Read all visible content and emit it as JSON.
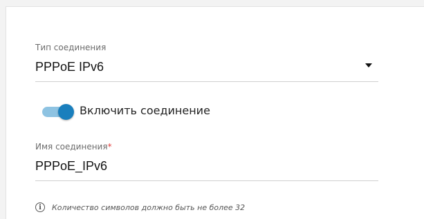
{
  "connection_type": {
    "label": "Тип соединения",
    "value": "PPPoE IPv6"
  },
  "enable_toggle": {
    "label": "Включить соединение",
    "state": "on"
  },
  "connection_name": {
    "label": "Имя соединения",
    "required_mark": "*",
    "value": "PPPoE_IPv6"
  },
  "hint": {
    "icon": "info-icon",
    "text": "Количество символов должно быть не более 32"
  },
  "colors": {
    "toggle_knob": "#1a7fbd",
    "toggle_track": "#8ec3e2",
    "required": "#e3413f"
  }
}
